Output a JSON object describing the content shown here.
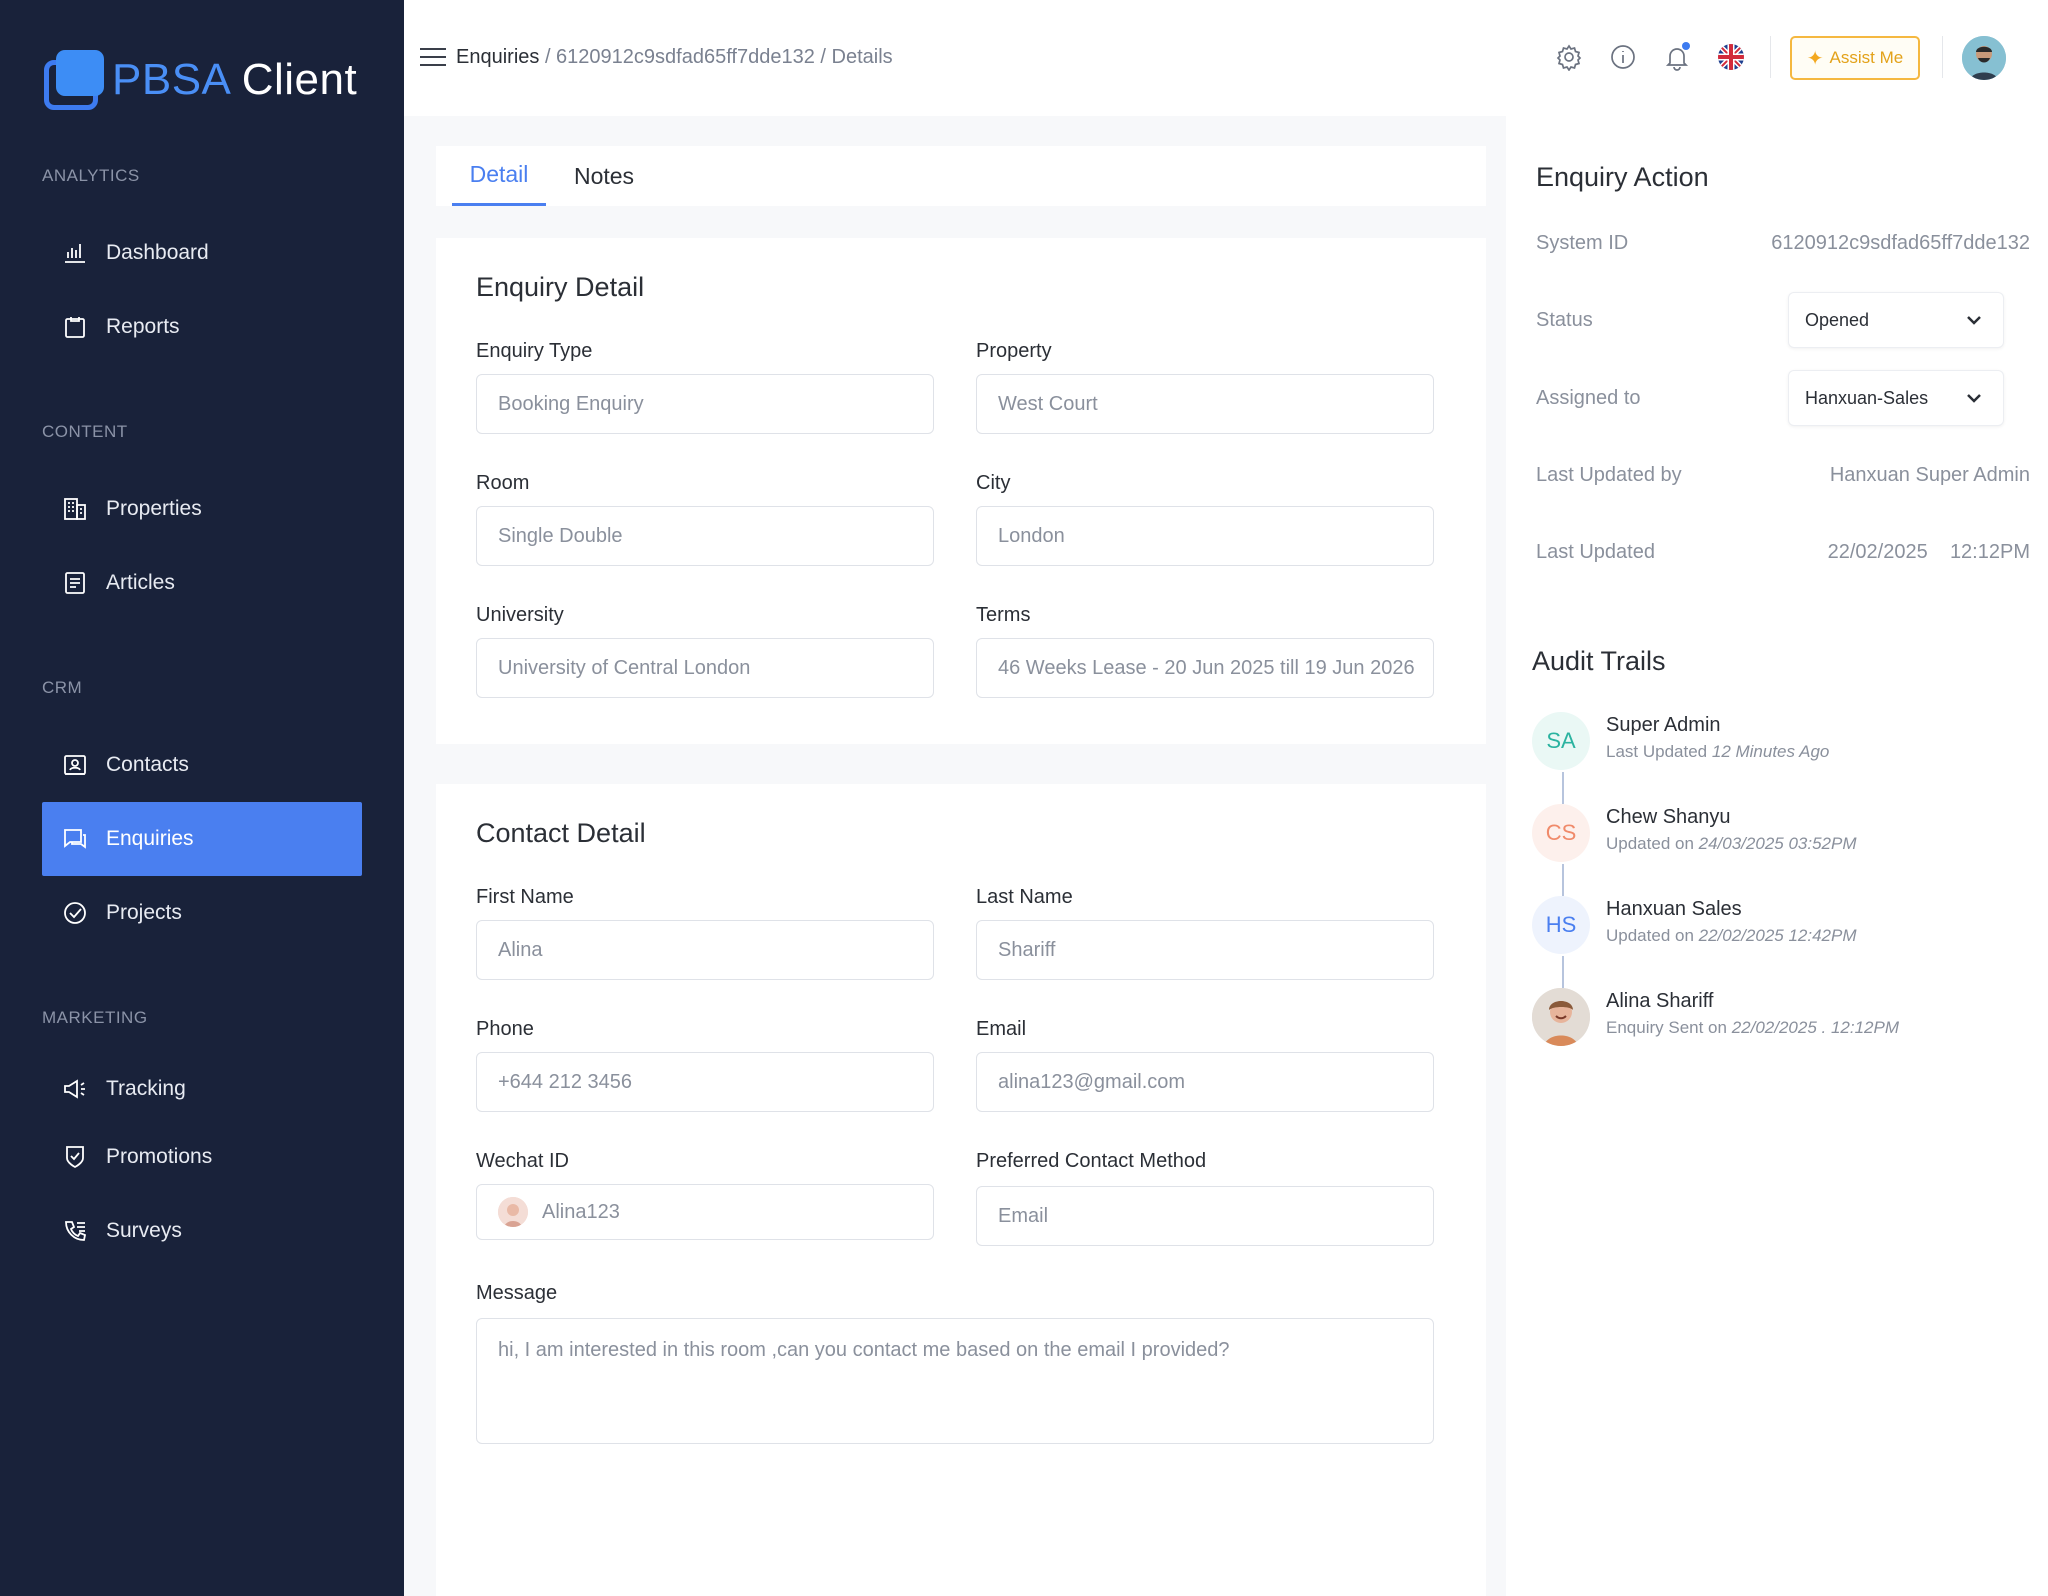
{
  "brand": {
    "part1": "PBSA",
    "part2": "Client"
  },
  "sidebar": {
    "sections": [
      {
        "label": "ANALYTICS"
      },
      {
        "label": "CONTENT"
      },
      {
        "label": "CRM"
      },
      {
        "label": "MARKETING"
      }
    ],
    "items": [
      {
        "label": "Dashboard",
        "icon": "bar-chart-icon"
      },
      {
        "label": "Reports",
        "icon": "clipboard-icon"
      },
      {
        "label": "Properties",
        "icon": "building-icon"
      },
      {
        "label": "Articles",
        "icon": "document-icon"
      },
      {
        "label": "Contacts",
        "icon": "contact-card-icon"
      },
      {
        "label": "Enquiries",
        "icon": "chat-icon",
        "active": true
      },
      {
        "label": "Projects",
        "icon": "check-circle-icon"
      },
      {
        "label": "Tracking",
        "icon": "megaphone-icon"
      },
      {
        "label": "Promotions",
        "icon": "shield-check-icon"
      },
      {
        "label": "Surveys",
        "icon": "phone-list-icon"
      }
    ],
    "active_color": "#4a7ff0"
  },
  "header": {
    "breadcrumb": {
      "first": "Enquiries",
      "rest": " / 6120912c9sdfad65ff7dde132 / Details"
    },
    "assist_label": "Assist Me"
  },
  "tabs": [
    {
      "label": "Detail",
      "active": true
    },
    {
      "label": "Notes",
      "active": false
    }
  ],
  "enquiry_detail": {
    "title": "Enquiry Detail",
    "fields": [
      {
        "label": "Enquiry Type",
        "value": "Booking Enquiry"
      },
      {
        "label": "Property",
        "value": "West Court"
      },
      {
        "label": "Room",
        "value": "Single Double"
      },
      {
        "label": "City",
        "value": "London"
      },
      {
        "label": "University",
        "value": "University of Central London"
      },
      {
        "label": "Terms",
        "value": "46 Weeks Lease - 20 Jun 2025 till 19 Jun 2026"
      }
    ]
  },
  "contact_detail": {
    "title": "Contact Detail",
    "fields": [
      {
        "label": "First Name",
        "value": "Alina"
      },
      {
        "label": "Last Name",
        "value": "Shariff"
      },
      {
        "label": "Phone",
        "value": "+644 212 3456"
      },
      {
        "label": "Email",
        "value": "alina123@gmail.com"
      },
      {
        "label": "Wechat ID",
        "value": "Alina123"
      },
      {
        "label": "Preferred Contact Method",
        "value": "Email"
      }
    ],
    "message": {
      "label": "Message",
      "value": "hi, I am interested in this room ,can you contact me based on the email I provided?"
    }
  },
  "enquiry_action": {
    "title": "Enquiry Action",
    "system_id": {
      "label": "System ID",
      "value": "6120912c9sdfad65ff7dde132"
    },
    "status": {
      "label": "Status",
      "value": "Opened"
    },
    "assigned_to": {
      "label": "Assigned to",
      "value": "Hanxuan-Sales"
    },
    "last_updated_by": {
      "label": "Last Updated by",
      "value": "Hanxuan Super Admin"
    },
    "last_updated": {
      "label": "Last Updated",
      "date": "22/02/2025",
      "time": "12:12PM"
    }
  },
  "audit_trails": {
    "title": "Audit Trails",
    "entries": [
      {
        "initials": "SA",
        "name": "Super Admin",
        "prefix": "Last Updated ",
        "detail": "12 Minutes Ago",
        "color": "#2bb3a0",
        "bg": "#eaf8f5"
      },
      {
        "initials": "CS",
        "name": "Chew Shanyu",
        "prefix": "Updated on ",
        "detail": "24/03/2025  03:52PM",
        "color": "#f08a6a",
        "bg": "#fdf0ec"
      },
      {
        "initials": "HS",
        "name": "Hanxuan Sales",
        "prefix": "Updated on ",
        "detail": "22/02/2025  12:42PM",
        "color": "#4a7ff0",
        "bg": "#eef3fd"
      },
      {
        "initials": "",
        "name": "Alina Shariff",
        "prefix": "Enquiry Sent on ",
        "detail": "22/02/2025 . 12:12PM",
        "color": "#8a6a4a",
        "bg": "#e8e2dc"
      }
    ]
  }
}
